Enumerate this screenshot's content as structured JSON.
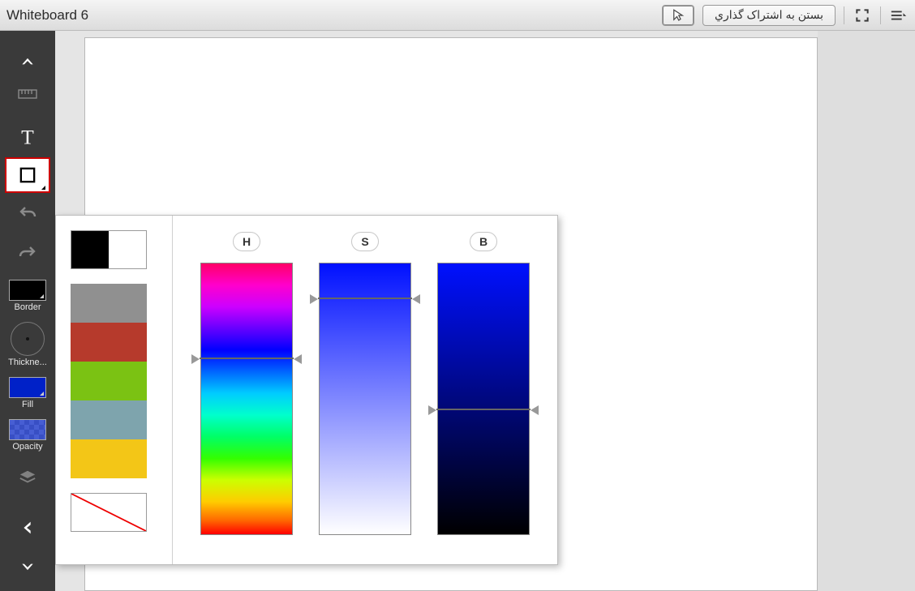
{
  "header": {
    "title": "Whiteboard 6",
    "share_button": "بستن به اشتراک گذاري"
  },
  "toolbar": {
    "border_label": "Border",
    "thickness_label": "Thickne...",
    "fill_label": "Fill",
    "opacity_label": "Opacity"
  },
  "picker": {
    "labels": {
      "h": "H",
      "s": "S",
      "b": "B"
    },
    "current_halves": [
      "#000000",
      "#ffffff"
    ],
    "palette": [
      "#909090",
      "#b63a2c",
      "#7bc213",
      "#7ea4ad",
      "#f3c617"
    ],
    "slider_positions": {
      "h_pct": 35,
      "s_pct": 13,
      "b_pct": 54
    }
  },
  "colors": {
    "border": "#000000",
    "fill": "#0021c8"
  }
}
